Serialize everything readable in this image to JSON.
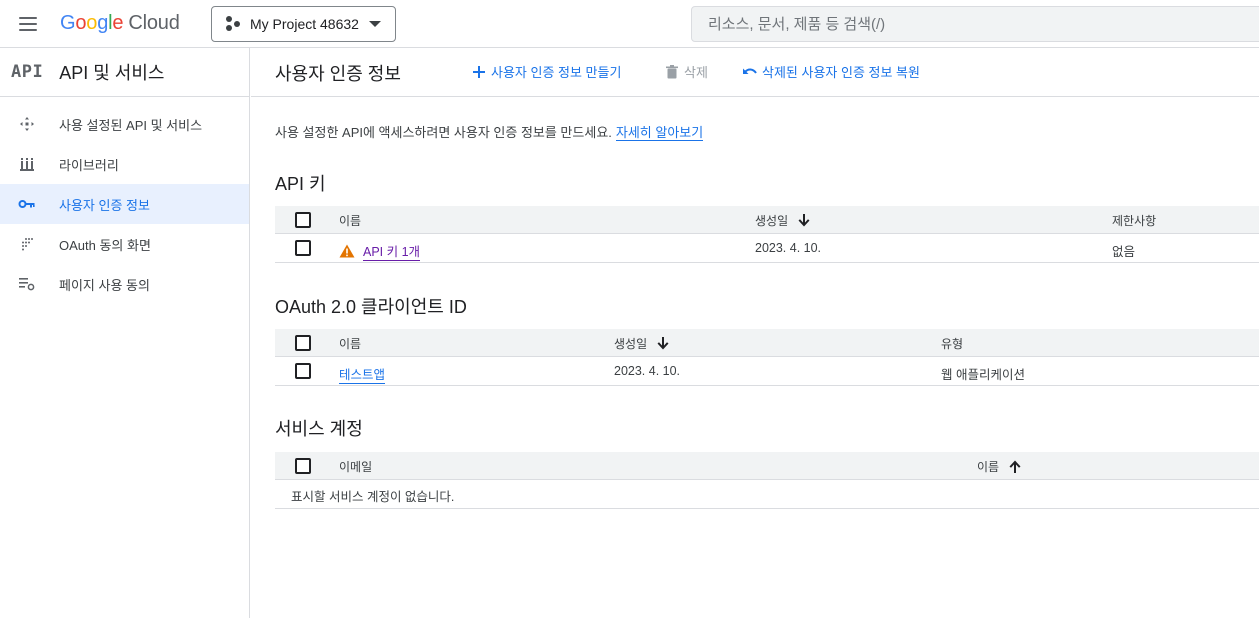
{
  "header": {
    "logo_google": [
      "G",
      "o",
      "o",
      "g",
      "l",
      "e"
    ],
    "logo_cloud": "Cloud",
    "project_name": "My Project 48632",
    "search_placeholder": "리소스, 문서, 제품 등 검색(/)"
  },
  "sidebar": {
    "badge": "API",
    "title": "API 및 서비스",
    "items": [
      {
        "label": "사용 설정된 API 및 서비스",
        "icon": "api-diamond-icon",
        "active": false
      },
      {
        "label": "라이브러리",
        "icon": "library-icon",
        "active": false
      },
      {
        "label": "사용자 인증 정보",
        "icon": "key-icon",
        "active": true
      },
      {
        "label": "OAuth 동의 화면",
        "icon": "oauth-dots-icon",
        "active": false
      },
      {
        "label": "페이지 사용 동의",
        "icon": "settings-list-icon",
        "active": false
      }
    ]
  },
  "toolbar": {
    "page_title": "사용자 인증 정보",
    "create_label": "사용자 인증 정보 만들기",
    "delete_label": "삭제",
    "restore_label": "삭제된 사용자 인증 정보 복원"
  },
  "intro": {
    "text": "사용 설정한 API에 액세스하려면 사용자 인증 정보를 만드세요.",
    "link": "자세히 알아보기"
  },
  "api_keys": {
    "title": "API 키",
    "columns": [
      "이름",
      "생성일",
      "제한사항"
    ],
    "rows": [
      {
        "name": "API 키 1개",
        "created": "2023. 4. 10.",
        "restrictions": "없음"
      }
    ]
  },
  "oauth": {
    "title": "OAuth 2.0 클라이언트 ID",
    "columns": [
      "이름",
      "생성일",
      "유형"
    ],
    "rows": [
      {
        "name": "테스트앱",
        "created": "2023. 4. 10.",
        "type": "웹 애플리케이션"
      }
    ]
  },
  "service_accounts": {
    "title": "서비스 계정",
    "columns": [
      "이메일",
      "이름"
    ],
    "empty_text": "표시할 서비스 계정이 없습니다."
  },
  "colors": {
    "accent": "#1a73e8",
    "warning": "#e37400",
    "visited_link": "#681da8"
  }
}
